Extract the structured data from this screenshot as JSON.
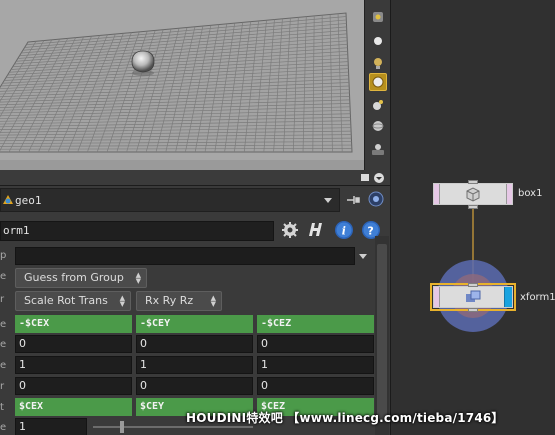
{
  "viewport": {
    "toolbar_icons": [
      "snap-icon",
      "point-icon",
      "light-icon",
      "camera-icon",
      "render-icon",
      "globe-icon",
      "more-icon"
    ],
    "active_tool": "camera-icon"
  },
  "parameters": {
    "path": "geo1",
    "node_name": "orm1",
    "group_type": "Guess from Group",
    "xform_order": "Scale Rot Trans",
    "rot_order": "Rx Ry Rz",
    "translate_expr": [
      "-$CEX",
      "-$CEY",
      "-$CEZ"
    ],
    "rotate": [
      "0",
      "0",
      "0"
    ],
    "scale": [
      "1",
      "1",
      "1"
    ],
    "shear": [
      "0",
      "0",
      "0"
    ],
    "pivot_expr": [
      "$CEX",
      "$CEY",
      "$CEZ"
    ],
    "uniform_scale": "1"
  },
  "network": {
    "nodes": [
      {
        "name": "box1",
        "flag_color": "#e6c8e6"
      },
      {
        "name": "xform1",
        "flag_color": "#18a3e0"
      }
    ],
    "accent": "#e8b22c",
    "handle_color": "#5b6bb0"
  },
  "watermark": "HOUDINI特效吧  【www.linecg.com/tieba/1746】"
}
